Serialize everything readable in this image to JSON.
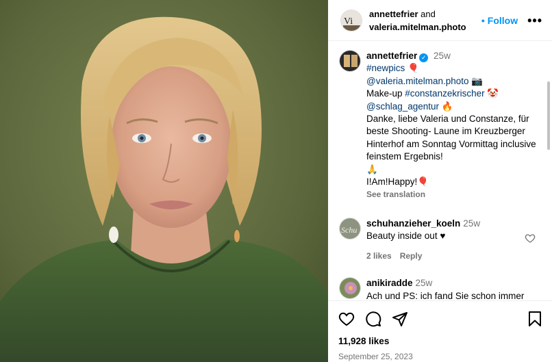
{
  "post": {
    "header": {
      "author": "annettefrier",
      "and_text": "and",
      "coauthor": "valeria.mitelman.photo",
      "follow_dot": "•",
      "follow_label": "Follow",
      "more_label": "•••"
    },
    "caption": {
      "username": "annettefrier",
      "time": "25w",
      "hashtag_newpics": "#newpics",
      "emoji_balloon": "🎈",
      "mention_photographer": "@valeria.mitelman.photo",
      "emoji_camera": "📷",
      "makeup_prefix": "Make-up ",
      "hashtag_makeup": "#constanzekrischer",
      "emoji_clown": "🤡",
      "mention_agency": "@schlag_agentur",
      "emoji_fire": "🔥",
      "text": "Danke, liebe Valeria und Constanze, für beste Shooting- Laune im Kreuzberger Hinterhof am Sonntag Vormittag inclusive feinstem Ergebnis!",
      "emoji_pray": "🙏",
      "closing": "I!Am!Happy!",
      "emoji_balloon2": "🎈",
      "see_translation": "See translation"
    },
    "comments": [
      {
        "username": "schuhanzieher_koeln",
        "time": "25w",
        "text": "Beauty inside out ♥",
        "likes": "2 likes",
        "reply": "Reply"
      },
      {
        "username": "anikiradde",
        "time": "25w",
        "text": "Ach und PS: ich fand Sie schon immer"
      }
    ],
    "likes_count": "11,928 likes",
    "date": "September 25, 2023"
  },
  "colors": {
    "accent": "#0095f6",
    "link": "#00376b",
    "muted": "#737373",
    "photo_background": "#5e6a3e",
    "top_color": "#3f5a2e"
  },
  "icons": [
    "verified-icon",
    "heart-icon",
    "comment-icon",
    "share-icon",
    "bookmark-icon",
    "more-options-icon"
  ]
}
